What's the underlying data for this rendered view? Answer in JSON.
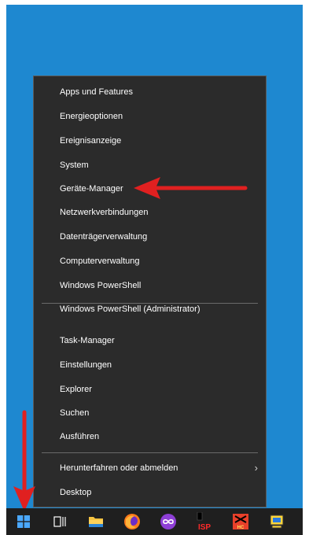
{
  "context_menu": {
    "items_group1": [
      {
        "label": "Apps und Features"
      },
      {
        "label": "Energieoptionen"
      },
      {
        "label": "Ereignisanzeige"
      },
      {
        "label": "System"
      },
      {
        "label": "Geräte-Manager"
      },
      {
        "label": "Netzwerkverbindungen"
      },
      {
        "label": "Datenträgerverwaltung"
      },
      {
        "label": "Computerverwaltung"
      },
      {
        "label": "Windows PowerShell"
      },
      {
        "label": "Windows PowerShell (Administrator)"
      }
    ],
    "items_group2": [
      {
        "label": "Task-Manager"
      },
      {
        "label": "Einstellungen"
      },
      {
        "label": "Explorer"
      },
      {
        "label": "Suchen"
      },
      {
        "label": "Ausführen"
      }
    ],
    "items_group3": [
      {
        "label": "Herunterfahren oder abmelden",
        "submenu_glyph": "›"
      },
      {
        "label": "Desktop"
      }
    ]
  },
  "taskbar": {
    "icons": [
      {
        "name": "start-icon"
      },
      {
        "name": "task-view-icon"
      },
      {
        "name": "file-explorer-icon"
      },
      {
        "name": "firefox-icon"
      },
      {
        "name": "app-infinity-icon"
      },
      {
        "name": "app-isp-icon",
        "badge": "ISP"
      },
      {
        "name": "app-red-icon",
        "badge": "HC"
      },
      {
        "name": "app-monitor-icon"
      }
    ]
  },
  "colors": {
    "desktop": "#1e88d0",
    "menu_bg": "#2b2b2b",
    "taskbar_bg": "#1f1f1f",
    "annotation_arrow": "#e02020"
  }
}
